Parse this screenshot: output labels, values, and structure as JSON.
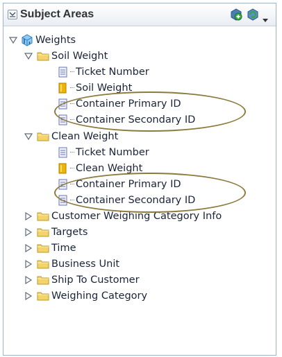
{
  "panel": {
    "title": "Subject Areas",
    "icons": [
      "collapse-toggle-icon",
      "add-subject-area-icon",
      "refresh-icon",
      "dropdown-arrow-icon"
    ]
  },
  "tree": {
    "root": {
      "label": "Weights",
      "expanded": true,
      "icon": "cube-icon"
    },
    "folders": [
      {
        "label": "Soil Weight",
        "expanded": true,
        "items": [
          {
            "label": "Ticket Number",
            "type": "attribute"
          },
          {
            "label": "Soil Weight",
            "type": "measure"
          },
          {
            "label": "Container Primary ID",
            "type": "attribute",
            "highlighted": true
          },
          {
            "label": "Container Secondary ID",
            "type": "attribute",
            "highlighted": true
          }
        ]
      },
      {
        "label": "Clean Weight",
        "expanded": true,
        "items": [
          {
            "label": "Ticket Number",
            "type": "attribute"
          },
          {
            "label": "Clean Weight",
            "type": "measure"
          },
          {
            "label": "Container Primary ID",
            "type": "attribute",
            "highlighted": true
          },
          {
            "label": "Container Secondary ID",
            "type": "attribute",
            "highlighted": true
          }
        ]
      },
      {
        "label": "Customer Weighing Category Info",
        "expanded": false
      },
      {
        "label": "Targets",
        "expanded": false
      },
      {
        "label": "Time",
        "expanded": false
      },
      {
        "label": "Business Unit",
        "expanded": false
      },
      {
        "label": "Ship To Customer",
        "expanded": false
      },
      {
        "label": "Weighing Category",
        "expanded": false
      }
    ]
  },
  "colors": {
    "folder": "#f4d46a",
    "folder_border": "#b9982a",
    "attribute_icon": "#6a73b8",
    "measure_icon": "#f0b400",
    "cube": "#3aa0e0",
    "annotation_oval": "#8b7a3a"
  }
}
